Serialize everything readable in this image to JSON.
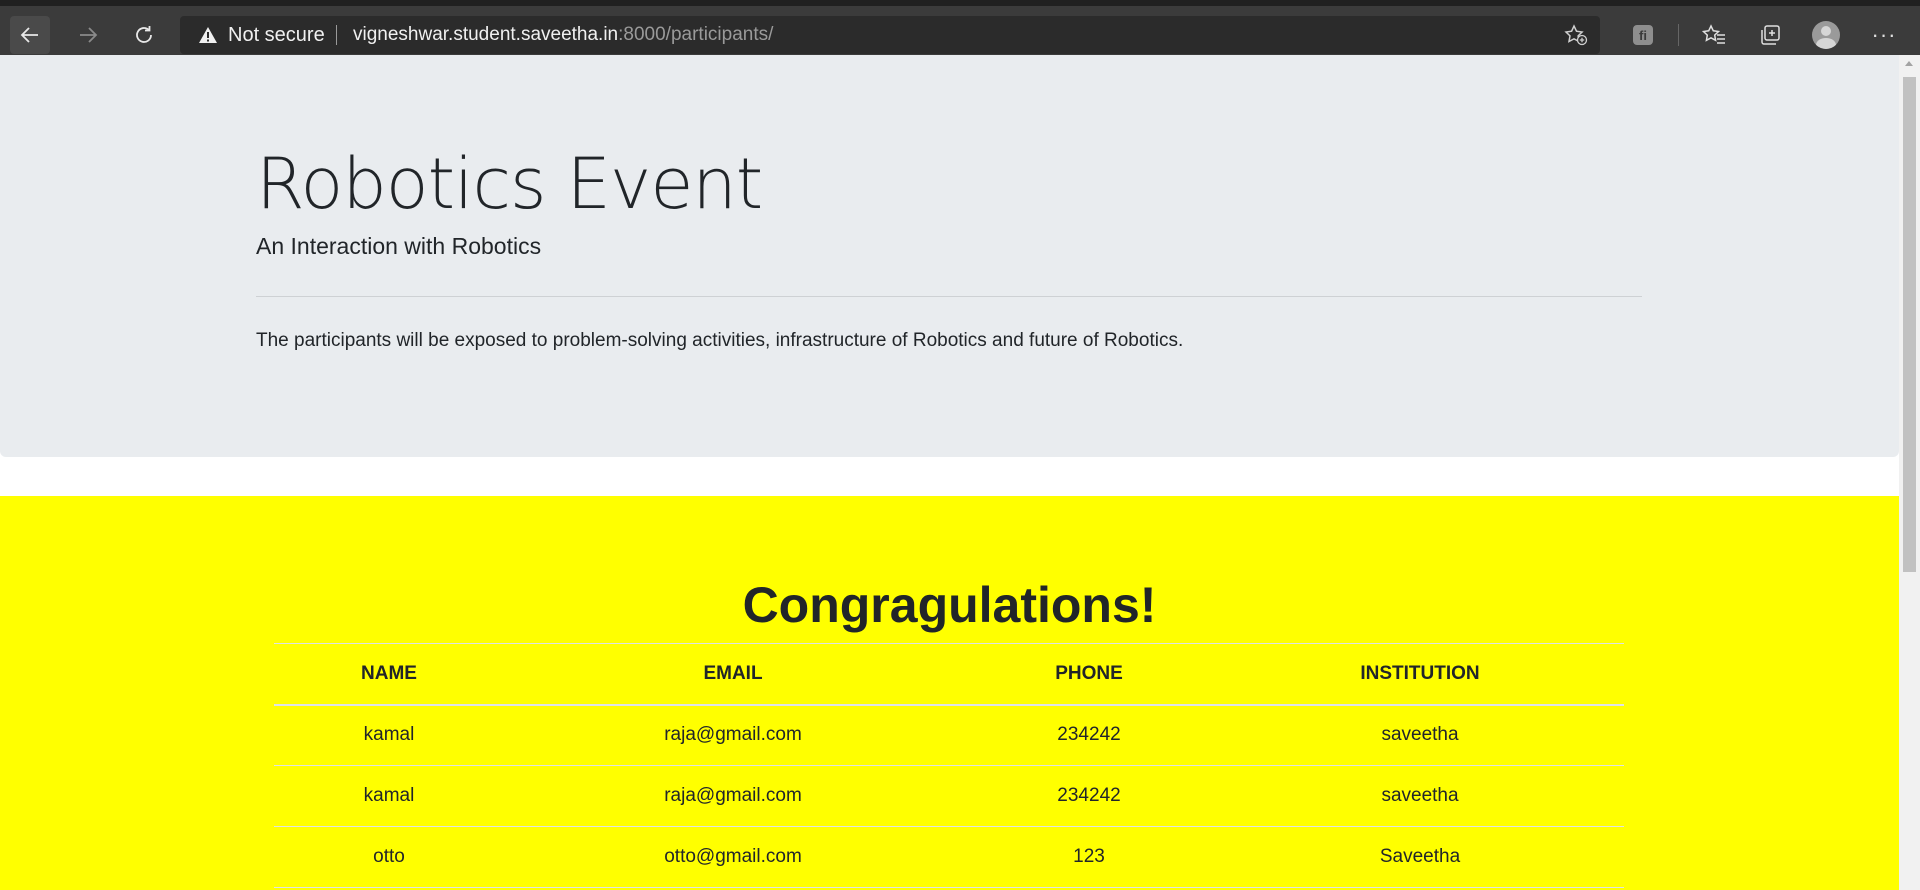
{
  "browser": {
    "security_label": "Not secure",
    "url_host": "vigneshwar.student.saveetha.in",
    "url_rest": ":8000/participants/",
    "icons": [
      "back-arrow-icon",
      "forward-arrow-icon",
      "reload-icon",
      "warning-icon",
      "add-favorite-icon",
      "extension-icon",
      "favorites-icon",
      "collections-icon",
      "profile-icon",
      "more-icon"
    ]
  },
  "jumbotron": {
    "title": "Robotics Event",
    "subtitle": "An Interaction with Robotics",
    "description": "The participants will be exposed to problem-solving activities, infrastructure of Robotics and future of Robotics."
  },
  "participants": {
    "heading": "Congragulations!",
    "columns": [
      "NAME",
      "EMAIL",
      "PHONE",
      "INSTITUTION"
    ],
    "rows": [
      [
        "kamal",
        "raja@gmail.com",
        "234242",
        "saveetha"
      ],
      [
        "kamal",
        "raja@gmail.com",
        "234242",
        "saveetha"
      ],
      [
        "otto",
        "otto@gmail.com",
        "123",
        "Saveetha"
      ]
    ],
    "background_color": "#ffff00"
  },
  "extension": {
    "badge": "fi"
  }
}
